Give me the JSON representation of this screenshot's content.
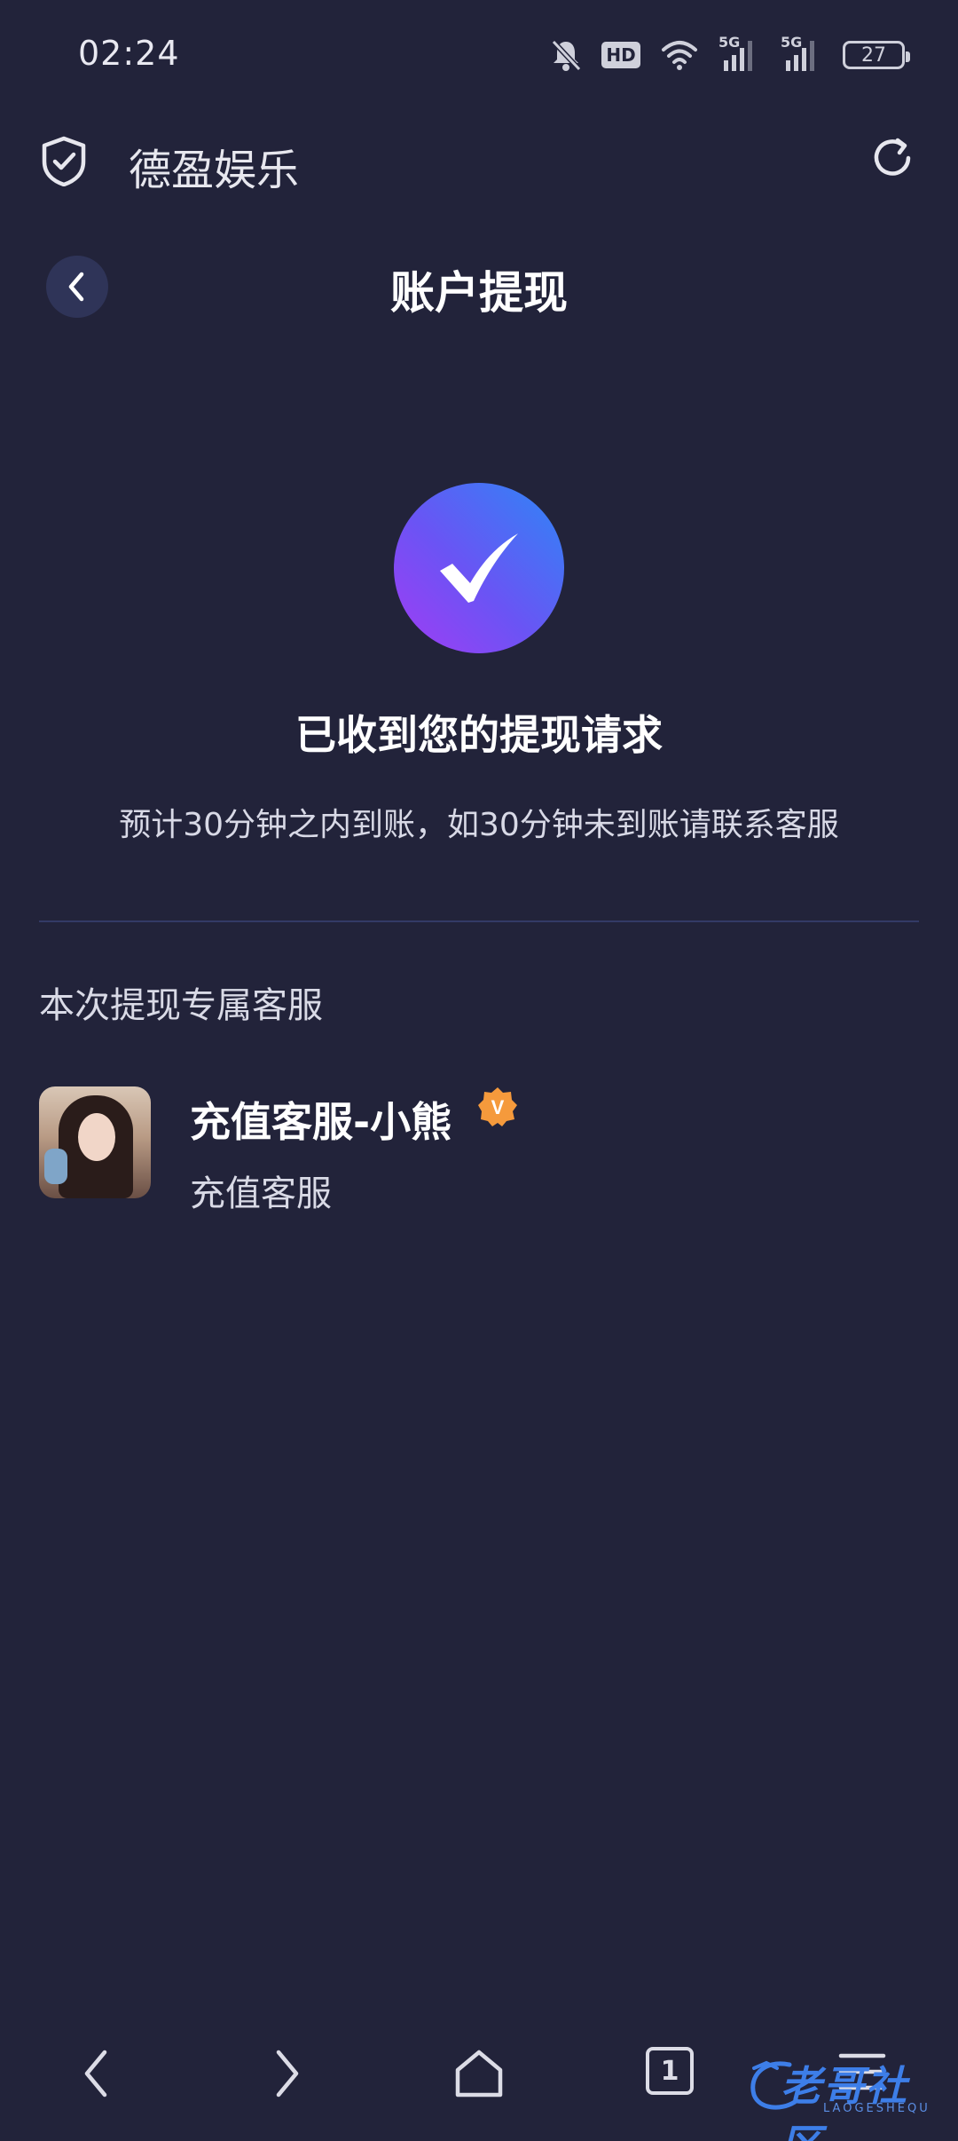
{
  "status_bar": {
    "time": "02:24",
    "hd_label": "HD",
    "net1": "5G",
    "net2": "5G",
    "battery": "27"
  },
  "app_bar": {
    "title": "德盈娱乐"
  },
  "header": {
    "title": "账户提现"
  },
  "success": {
    "title": "已收到您的提现请求",
    "description": "预计30分钟之内到账，如30分钟未到账请联系客服"
  },
  "service": {
    "section_label": "本次提现专属客服",
    "agent_name": "充值客服-小熊",
    "badge_letter": "V",
    "agent_role": "充值客服"
  },
  "bottom_nav": {
    "tabs_count": "1"
  },
  "watermark": {
    "text": "老哥社区",
    "sub": "LAOGESHEQU"
  },
  "colors": {
    "background": "#22233a",
    "accent_gradient_start": "#a23cf4",
    "accent_gradient_end": "#2e86f6",
    "badge": "#f59a3c",
    "divider": "#333a66"
  },
  "icons": [
    "mute-icon",
    "wifi-icon",
    "signal-icon",
    "shield-check-icon",
    "refresh-icon",
    "back-chevron-icon",
    "checkmark-icon",
    "verified-badge-icon",
    "nav-back-icon",
    "nav-forward-icon",
    "home-icon",
    "tabs-icon",
    "menu-icon"
  ]
}
